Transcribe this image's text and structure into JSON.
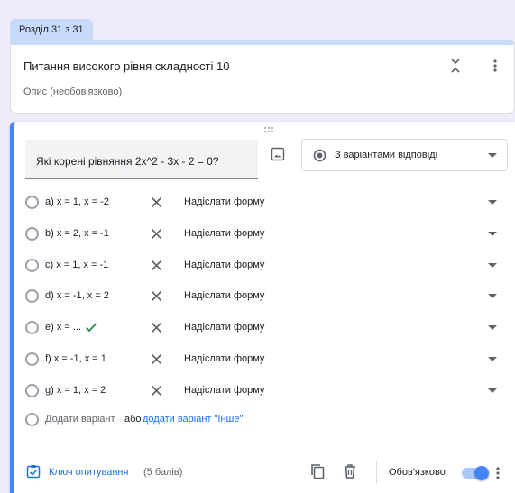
{
  "section": {
    "tab_label": "Розділ 31 з 31",
    "title": "Питання високого рівня складності 10",
    "description_placeholder": "Опис (необов'язково)"
  },
  "question": {
    "text": "Які корені рівняння 2x^2 - 3x - 2 = 0?",
    "type_label": "З варіантами відповіді",
    "options": [
      {
        "label": "a) x = 1, x = -2",
        "correct": false,
        "goto": "Надіслати форму"
      },
      {
        "label": "b) x = 2, x = -1",
        "correct": false,
        "goto": "Надіслати форму"
      },
      {
        "label": "c) x = 1, x = -1",
        "correct": false,
        "goto": "Надіслати форму"
      },
      {
        "label": "d) x = -1, x = 2",
        "correct": false,
        "goto": "Надіслати форму"
      },
      {
        "label": "e) x = ...",
        "correct": true,
        "goto": "Надіслати форму"
      },
      {
        "label": "f) x = -1, x = 1",
        "correct": false,
        "goto": "Надіслати форму"
      },
      {
        "label": "g) x = 1, x = 2",
        "correct": false,
        "goto": "Надіслати форму"
      }
    ],
    "add_option_label": "Додати варіант",
    "or_label": "або",
    "add_other_label": "додати варіант \"Інше\""
  },
  "footer": {
    "answer_key_label": "Ключ опитування",
    "points_label": "(5 балів)",
    "required_label": "Обов'язково",
    "required_on": true
  },
  "colors": {
    "accent": "#4285f4",
    "link": "#1a73e8",
    "correct_check": "#1e8e3e",
    "section_tab": "#c6dafc",
    "background": "#f0ebf8"
  },
  "icons": [
    "collapse-icon",
    "more-vert-icon",
    "drag-handle-icon",
    "image-icon",
    "radio-icon",
    "chevron-down-icon",
    "remove-icon",
    "check-icon",
    "answer-key-icon",
    "copy-icon",
    "trash-icon",
    "toggle-switch"
  ]
}
